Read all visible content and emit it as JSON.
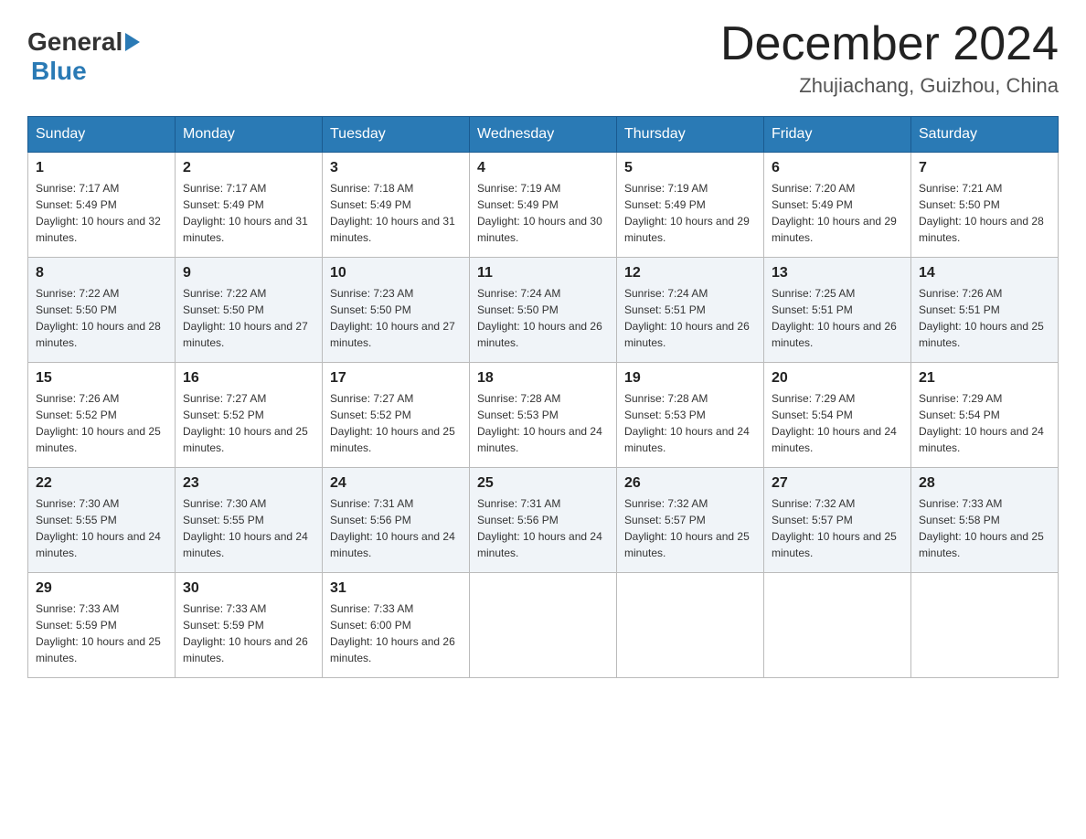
{
  "header": {
    "logo": {
      "general": "General",
      "blue": "Blue",
      "arrow_symbol": "▶"
    },
    "title": "December 2024",
    "location": "Zhujiachang, Guizhou, China"
  },
  "days_of_week": [
    "Sunday",
    "Monday",
    "Tuesday",
    "Wednesday",
    "Thursday",
    "Friday",
    "Saturday"
  ],
  "weeks": [
    [
      {
        "day": "1",
        "sunrise": "Sunrise: 7:17 AM",
        "sunset": "Sunset: 5:49 PM",
        "daylight": "Daylight: 10 hours and 32 minutes."
      },
      {
        "day": "2",
        "sunrise": "Sunrise: 7:17 AM",
        "sunset": "Sunset: 5:49 PM",
        "daylight": "Daylight: 10 hours and 31 minutes."
      },
      {
        "day": "3",
        "sunrise": "Sunrise: 7:18 AM",
        "sunset": "Sunset: 5:49 PM",
        "daylight": "Daylight: 10 hours and 31 minutes."
      },
      {
        "day": "4",
        "sunrise": "Sunrise: 7:19 AM",
        "sunset": "Sunset: 5:49 PM",
        "daylight": "Daylight: 10 hours and 30 minutes."
      },
      {
        "day": "5",
        "sunrise": "Sunrise: 7:19 AM",
        "sunset": "Sunset: 5:49 PM",
        "daylight": "Daylight: 10 hours and 29 minutes."
      },
      {
        "day": "6",
        "sunrise": "Sunrise: 7:20 AM",
        "sunset": "Sunset: 5:49 PM",
        "daylight": "Daylight: 10 hours and 29 minutes."
      },
      {
        "day": "7",
        "sunrise": "Sunrise: 7:21 AM",
        "sunset": "Sunset: 5:50 PM",
        "daylight": "Daylight: 10 hours and 28 minutes."
      }
    ],
    [
      {
        "day": "8",
        "sunrise": "Sunrise: 7:22 AM",
        "sunset": "Sunset: 5:50 PM",
        "daylight": "Daylight: 10 hours and 28 minutes."
      },
      {
        "day": "9",
        "sunrise": "Sunrise: 7:22 AM",
        "sunset": "Sunset: 5:50 PM",
        "daylight": "Daylight: 10 hours and 27 minutes."
      },
      {
        "day": "10",
        "sunrise": "Sunrise: 7:23 AM",
        "sunset": "Sunset: 5:50 PM",
        "daylight": "Daylight: 10 hours and 27 minutes."
      },
      {
        "day": "11",
        "sunrise": "Sunrise: 7:24 AM",
        "sunset": "Sunset: 5:50 PM",
        "daylight": "Daylight: 10 hours and 26 minutes."
      },
      {
        "day": "12",
        "sunrise": "Sunrise: 7:24 AM",
        "sunset": "Sunset: 5:51 PM",
        "daylight": "Daylight: 10 hours and 26 minutes."
      },
      {
        "day": "13",
        "sunrise": "Sunrise: 7:25 AM",
        "sunset": "Sunset: 5:51 PM",
        "daylight": "Daylight: 10 hours and 26 minutes."
      },
      {
        "day": "14",
        "sunrise": "Sunrise: 7:26 AM",
        "sunset": "Sunset: 5:51 PM",
        "daylight": "Daylight: 10 hours and 25 minutes."
      }
    ],
    [
      {
        "day": "15",
        "sunrise": "Sunrise: 7:26 AM",
        "sunset": "Sunset: 5:52 PM",
        "daylight": "Daylight: 10 hours and 25 minutes."
      },
      {
        "day": "16",
        "sunrise": "Sunrise: 7:27 AM",
        "sunset": "Sunset: 5:52 PM",
        "daylight": "Daylight: 10 hours and 25 minutes."
      },
      {
        "day": "17",
        "sunrise": "Sunrise: 7:27 AM",
        "sunset": "Sunset: 5:52 PM",
        "daylight": "Daylight: 10 hours and 25 minutes."
      },
      {
        "day": "18",
        "sunrise": "Sunrise: 7:28 AM",
        "sunset": "Sunset: 5:53 PM",
        "daylight": "Daylight: 10 hours and 24 minutes."
      },
      {
        "day": "19",
        "sunrise": "Sunrise: 7:28 AM",
        "sunset": "Sunset: 5:53 PM",
        "daylight": "Daylight: 10 hours and 24 minutes."
      },
      {
        "day": "20",
        "sunrise": "Sunrise: 7:29 AM",
        "sunset": "Sunset: 5:54 PM",
        "daylight": "Daylight: 10 hours and 24 minutes."
      },
      {
        "day": "21",
        "sunrise": "Sunrise: 7:29 AM",
        "sunset": "Sunset: 5:54 PM",
        "daylight": "Daylight: 10 hours and 24 minutes."
      }
    ],
    [
      {
        "day": "22",
        "sunrise": "Sunrise: 7:30 AM",
        "sunset": "Sunset: 5:55 PM",
        "daylight": "Daylight: 10 hours and 24 minutes."
      },
      {
        "day": "23",
        "sunrise": "Sunrise: 7:30 AM",
        "sunset": "Sunset: 5:55 PM",
        "daylight": "Daylight: 10 hours and 24 minutes."
      },
      {
        "day": "24",
        "sunrise": "Sunrise: 7:31 AM",
        "sunset": "Sunset: 5:56 PM",
        "daylight": "Daylight: 10 hours and 24 minutes."
      },
      {
        "day": "25",
        "sunrise": "Sunrise: 7:31 AM",
        "sunset": "Sunset: 5:56 PM",
        "daylight": "Daylight: 10 hours and 24 minutes."
      },
      {
        "day": "26",
        "sunrise": "Sunrise: 7:32 AM",
        "sunset": "Sunset: 5:57 PM",
        "daylight": "Daylight: 10 hours and 25 minutes."
      },
      {
        "day": "27",
        "sunrise": "Sunrise: 7:32 AM",
        "sunset": "Sunset: 5:57 PM",
        "daylight": "Daylight: 10 hours and 25 minutes."
      },
      {
        "day": "28",
        "sunrise": "Sunrise: 7:33 AM",
        "sunset": "Sunset: 5:58 PM",
        "daylight": "Daylight: 10 hours and 25 minutes."
      }
    ],
    [
      {
        "day": "29",
        "sunrise": "Sunrise: 7:33 AM",
        "sunset": "Sunset: 5:59 PM",
        "daylight": "Daylight: 10 hours and 25 minutes."
      },
      {
        "day": "30",
        "sunrise": "Sunrise: 7:33 AM",
        "sunset": "Sunset: 5:59 PM",
        "daylight": "Daylight: 10 hours and 26 minutes."
      },
      {
        "day": "31",
        "sunrise": "Sunrise: 7:33 AM",
        "sunset": "Sunset: 6:00 PM",
        "daylight": "Daylight: 10 hours and 26 minutes."
      },
      null,
      null,
      null,
      null
    ]
  ]
}
